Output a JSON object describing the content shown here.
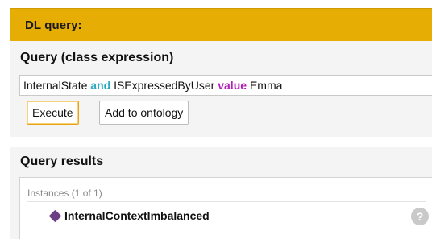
{
  "header": {
    "title": "DL query:"
  },
  "query": {
    "heading": "Query (class expression)",
    "expression": {
      "part1": "InternalState",
      "keyword_and": "and",
      "part2": "ISExpressedByUser",
      "keyword_value": "value",
      "part3": "Emma"
    },
    "execute_label": "Execute",
    "add_label": "Add to ontology"
  },
  "results": {
    "heading": "Query results",
    "section_label": "Instances (1 of 1)",
    "items": [
      {
        "label": "InternalContextImbalanced",
        "icon": "individual-diamond-icon"
      }
    ],
    "help_glyph": "?"
  },
  "colors": {
    "header_bg": "#e6ad05",
    "keyword_and": "#2aa9c1",
    "keyword_value": "#b01fb8",
    "individual_icon": "#6c3e86"
  }
}
